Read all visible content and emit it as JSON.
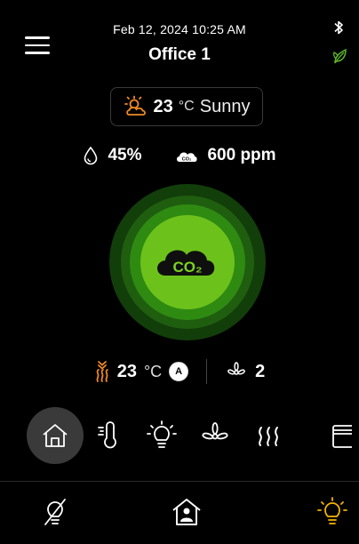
{
  "header": {
    "datetime": "Feb 12, 2024  10:25 AM",
    "room": "Office 1",
    "bluetooth_icon": "bluetooth-icon",
    "eco_icon": "leaf-icon"
  },
  "weather": {
    "icon": "partly-sunny-icon",
    "temperature": "23",
    "unit": "°C",
    "condition": "Sunny"
  },
  "metrics": {
    "humidity": "45%",
    "humidity_icon": "water-drop-icon",
    "co2": "600 ppm",
    "co2_icon": "co2-cloud-icon"
  },
  "air_quality": {
    "label": "CO₂",
    "status_color": "#6cc21b"
  },
  "controls": {
    "heating_temperature": "23",
    "heating_unit": "°C",
    "mode_badge": "A",
    "fan_level": "2"
  },
  "mode_bar": [
    {
      "name": "home",
      "active": true
    },
    {
      "name": "thermometer",
      "active": false
    },
    {
      "name": "light",
      "active": false
    },
    {
      "name": "fan",
      "active": false
    },
    {
      "name": "heating",
      "active": false
    },
    {
      "name": "blinds",
      "active": false
    }
  ],
  "bottom_nav": [
    {
      "name": "light-off"
    },
    {
      "name": "home-occupied"
    },
    {
      "name": "light-on",
      "color": "#f5b400"
    }
  ],
  "colors": {
    "accent_orange": "#f08a24",
    "accent_yellow": "#f5b400",
    "green_inner": "#6cc21b",
    "green_mid": "#2f8a12",
    "green_outer": "#123e0a"
  }
}
